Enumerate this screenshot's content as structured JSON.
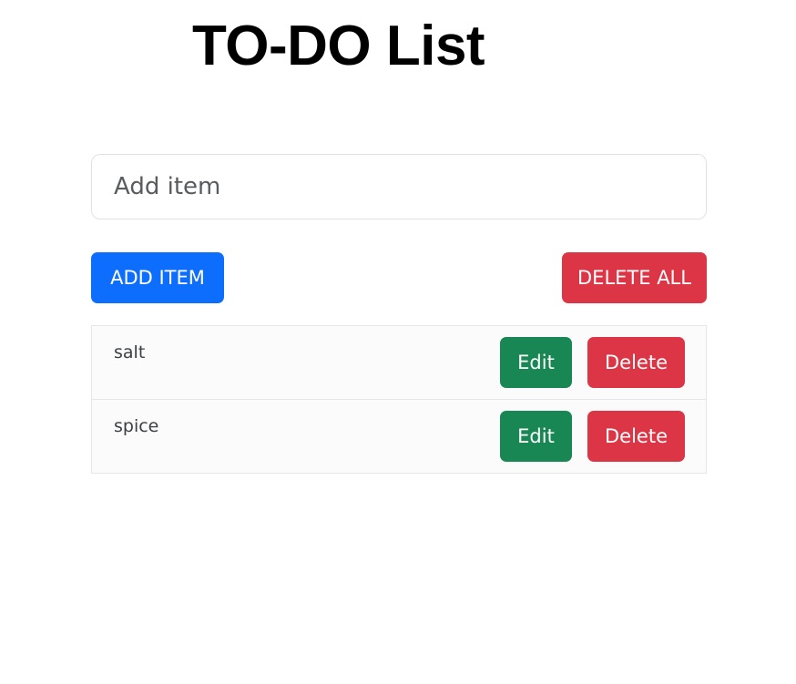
{
  "header": {
    "title": "TO-DO List"
  },
  "form": {
    "placeholder": "Add item",
    "value": "",
    "add_label": "ADD ITEM",
    "delete_all_label": "DELETE ALL"
  },
  "items": [
    {
      "text": "salt",
      "edit_label": "Edit",
      "delete_label": "Delete"
    },
    {
      "text": "spice",
      "edit_label": "Edit",
      "delete_label": "Delete"
    }
  ],
  "colors": {
    "primary": "#0d6efd",
    "danger": "#dc3545",
    "success": "#198754"
  }
}
